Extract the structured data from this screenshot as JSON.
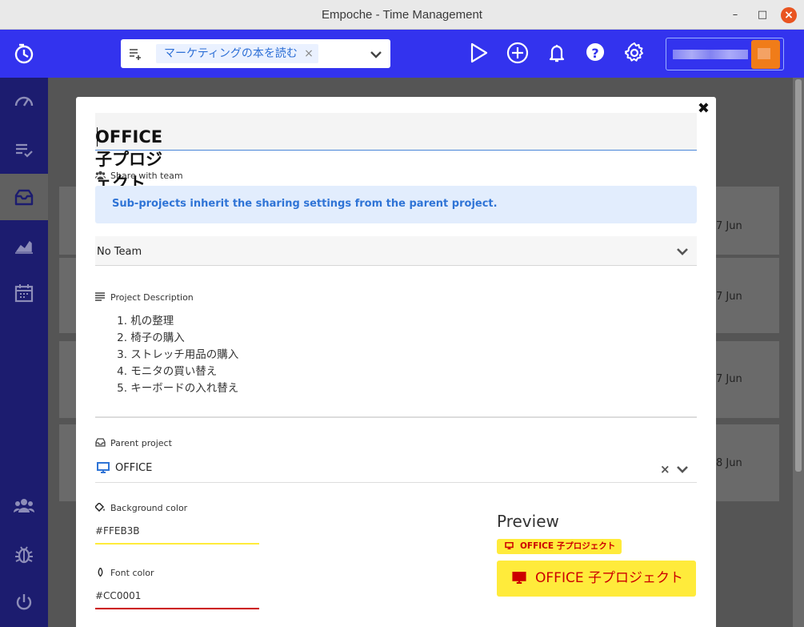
{
  "window": {
    "title": "Empoche - Time Management",
    "minimize": "–",
    "maximize": "□",
    "close": "×"
  },
  "header": {
    "search_chip": "マーケティングの本を読む",
    "search_chip_clear": "×",
    "icons": [
      "play-icon",
      "add-icon",
      "bell-icon",
      "help-icon",
      "settings-icon"
    ]
  },
  "sidebar": {
    "items": [
      "dashboard-icon",
      "tasks-icon",
      "projects-icon",
      "reports-icon",
      "calendar-icon",
      "team-icon",
      "bug-icon",
      "power-icon"
    ],
    "active": "projects-icon"
  },
  "background": {
    "dates": [
      "7 Jun",
      "7 Jun",
      "7 Jun",
      "8 Jun"
    ]
  },
  "modal": {
    "close": "✖",
    "project_name": "OFFICE 子プロジェクト",
    "share_label": "Share with team",
    "share_info": "Sub-projects inherit the sharing settings from the parent project.",
    "team_value": "No Team",
    "description_label": "Project Description",
    "description_items": [
      {
        "n": "1.",
        "t": "机の整理"
      },
      {
        "n": "2.",
        "t": "椅子の購入"
      },
      {
        "n": "3.",
        "t": "ストレッチ用品の購入"
      },
      {
        "n": "4.",
        "t": "モニタの買い替え"
      },
      {
        "n": "5.",
        "t": "キーボードの入れ替え"
      }
    ],
    "parent_label": "Parent project",
    "parent_value": "OFFICE",
    "parent_clear": "×",
    "bg_label": "Background color",
    "bg_value": "#FFEB3B",
    "font_label": "Font color",
    "font_value": "#CC0001",
    "preview_title": "Preview",
    "preview_small": "OFFICE 子プロジェクト",
    "preview_big": "OFFICE 子プロジェクト"
  },
  "colors": {
    "appbar": "#3333ee",
    "sidebar": "#1c1c6f",
    "accent_blue": "#2f74d6",
    "preview_bg": "#FFEB3B",
    "preview_fg": "#CC0001"
  }
}
